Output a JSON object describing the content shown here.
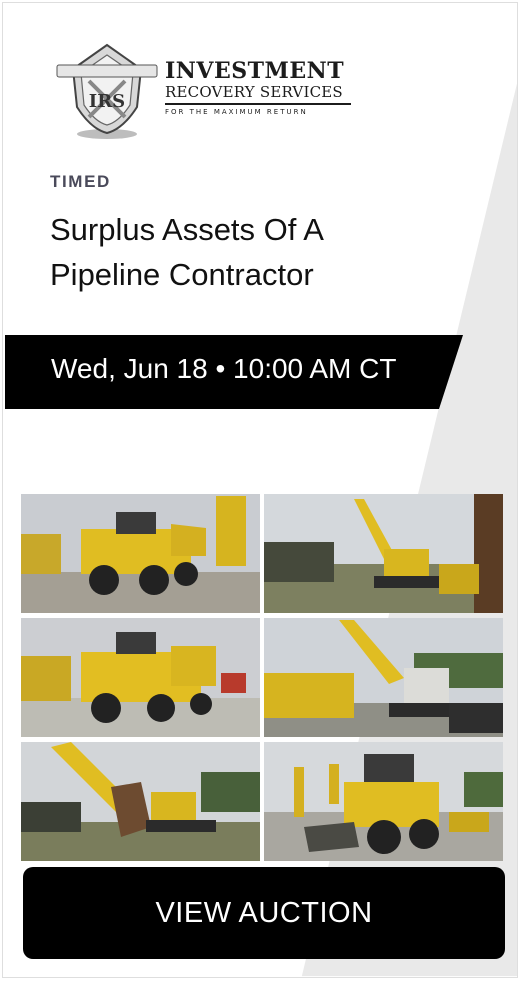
{
  "logo": {
    "line1": "INVESTMENT",
    "line2": "RECOVERY SERVICES",
    "line3": "FOR THE MAXIMUM RETURN",
    "badge_initials": "IRS"
  },
  "auction": {
    "type": "TIMED",
    "title": "Surplus Assets Of A Pipeline Contractor",
    "date": "Wed, Jun 18 • 10:00 AM CT"
  },
  "photos": [
    {
      "icon": "articulated-dump-truck-photo"
    },
    {
      "icon": "excavator-photo"
    },
    {
      "icon": "dump-trucks-photo"
    },
    {
      "icon": "excavator-yard-photo"
    },
    {
      "icon": "excavator-bucket-photo"
    },
    {
      "icon": "wheel-loader-photo"
    }
  ],
  "cta": {
    "label": "VIEW AUCTION"
  },
  "colors": {
    "banner": "#000000",
    "button": "#000000",
    "equipment": "#e6c21f",
    "stripe": "#e9e9e9"
  }
}
